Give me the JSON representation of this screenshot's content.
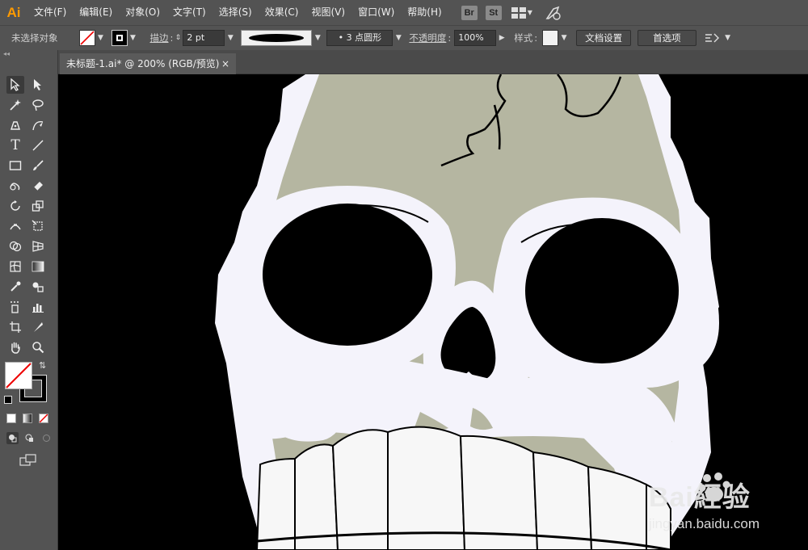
{
  "app": {
    "logo": "Ai",
    "menu": [
      "文件(F)",
      "编辑(E)",
      "对象(O)",
      "文字(T)",
      "选择(S)",
      "效果(C)",
      "视图(V)",
      "窗口(W)",
      "帮助(H)"
    ],
    "bridge_buttons": [
      "Br",
      "St"
    ],
    "accent_color": "#ff9a00"
  },
  "control_bar": {
    "selection_label": "未选择对象",
    "stroke_label": "描边",
    "stroke_value": "2 pt",
    "brush_label": "3 点圆形",
    "opacity_label": "不透明度",
    "opacity_value": "100%",
    "style_label": "样式",
    "doc_setup_button": "文档设置",
    "preferences_button": "首选项"
  },
  "document": {
    "tab_title": "未标题-1.ai* @ 200% (RGB/预览)",
    "close_glyph": "×"
  },
  "canvas": {
    "background": "#000000",
    "skull_color": "#b5b6a1",
    "bone_color": "#f4f3fb",
    "teeth_color": "#f7f7f7"
  },
  "watermark": {
    "brand": "Bai經验",
    "url": "jingyan.baidu.com"
  }
}
